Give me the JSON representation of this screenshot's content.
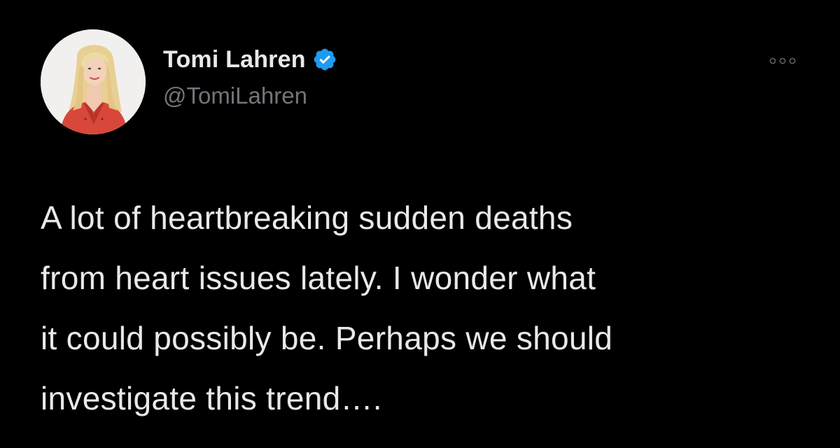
{
  "tweet": {
    "author": {
      "display_name": "Tomi Lahren",
      "handle": "@TomiLahren",
      "verified": true,
      "avatar_icon": "profile-photo"
    },
    "more_icon": "more-horizontal-icon",
    "body_lines": [
      "A lot of heartbreaking sudden deaths",
      "from heart issues lately. I wonder what",
      "it could possibly be. Perhaps we should",
      "investigate this trend…."
    ]
  },
  "colors": {
    "background": "#000000",
    "primary_text": "#e7e9ea",
    "secondary_text": "#71767b",
    "verified_badge": "#1d9bf0"
  }
}
